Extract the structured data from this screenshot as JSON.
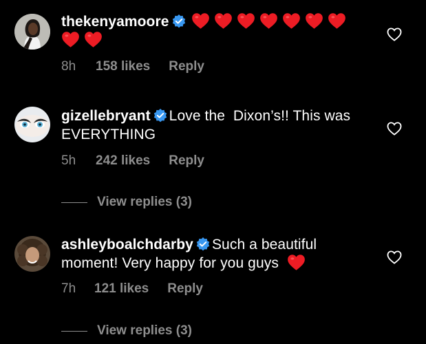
{
  "comments": [
    {
      "username": "thekenyamoore",
      "text": "",
      "heart_count": 9,
      "time": "8h",
      "likes": "158 likes",
      "reply_label": "Reply",
      "avatar_icon": "profile-photo"
    },
    {
      "username": "gizellebryant",
      "text": "Love the  Dixon’s!! This was EVERYTHING",
      "time": "5h",
      "likes": "242 likes",
      "reply_label": "Reply",
      "view_replies": "View replies (3)",
      "avatar_icon": "profile-photo"
    },
    {
      "username": "ashleyboalchdarby",
      "text": "Such a beautiful moment! Very happy for you guys",
      "trailing_heart": true,
      "time": "7h",
      "likes": "121 likes",
      "reply_label": "Reply",
      "view_replies": "View replies (3)",
      "avatar_icon": "profile-photo"
    }
  ],
  "colors": {
    "background": "#000000",
    "text": "#ffffff",
    "muted": "#8e8e8e",
    "verified": "#3897f0",
    "heart": "#ed1c24"
  },
  "icons": {
    "verified": "verified-badge-icon",
    "like": "heart-outline-icon",
    "emoji": "red-heart-emoji"
  }
}
